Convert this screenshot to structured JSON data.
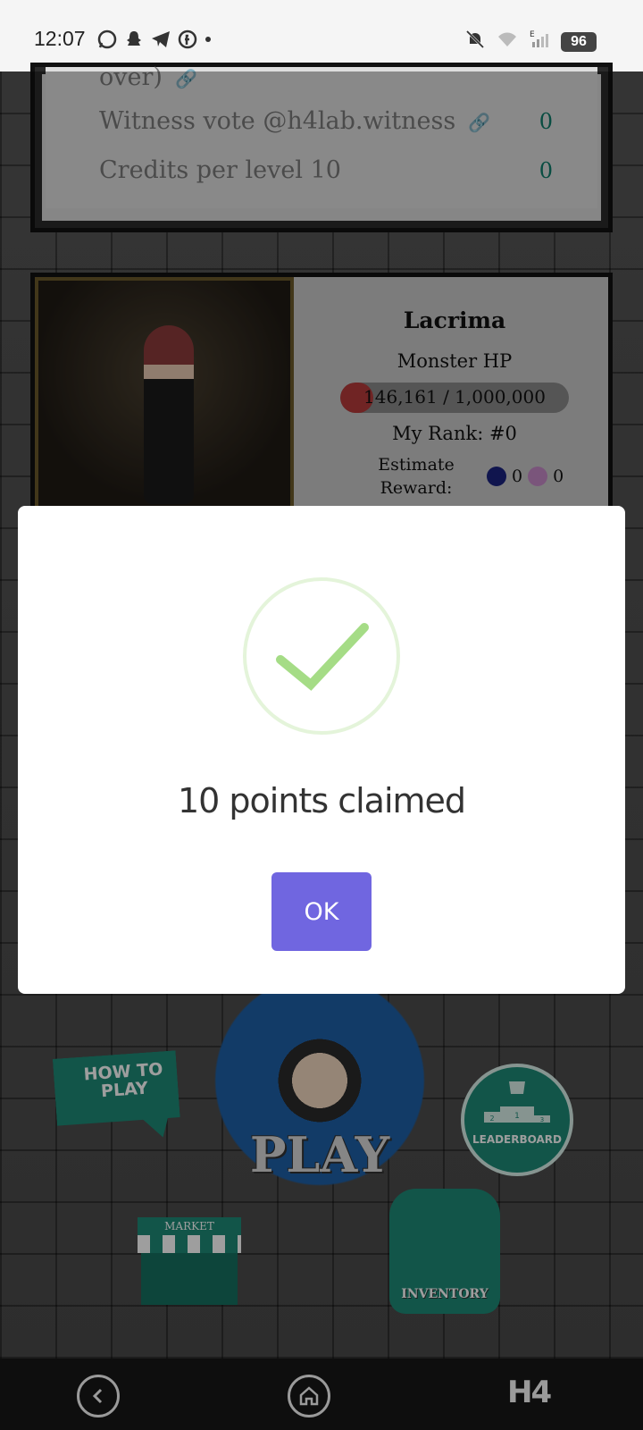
{
  "status_bar": {
    "time": "12:07",
    "battery": "96",
    "network": "E"
  },
  "tasks": {
    "partial_row": "over)",
    "rows": [
      {
        "label": "Witness vote @h4lab.witness",
        "value": "0"
      },
      {
        "label": "Credits per level 10",
        "value": "0"
      }
    ]
  },
  "boss": {
    "name": "Lacrima",
    "hp_label": "Monster HP",
    "hp_text": "146,161 / 1,000,000",
    "hp_fraction": 0.146,
    "rank": "My Rank: #0",
    "reward_label": "Estimate Reward:",
    "reward_values": [
      "0",
      "0"
    ]
  },
  "menu": {
    "how_to_play": "HOW TO PLAY",
    "play": "PLAY",
    "leaderboard": "LEADERBOARD",
    "leaderboard_ranks": [
      "2",
      "1",
      "3"
    ],
    "market": "MARKET",
    "inventory": "INVENTORY"
  },
  "dialog": {
    "title": "10 points claimed",
    "ok_label": "OK"
  },
  "nav": {
    "app_logo": "H4"
  },
  "colors": {
    "accent_teal": "#1e8a77",
    "success_green": "#a5dc86",
    "confirm_button": "#7066e0",
    "hp_red": "#b53a3a"
  }
}
